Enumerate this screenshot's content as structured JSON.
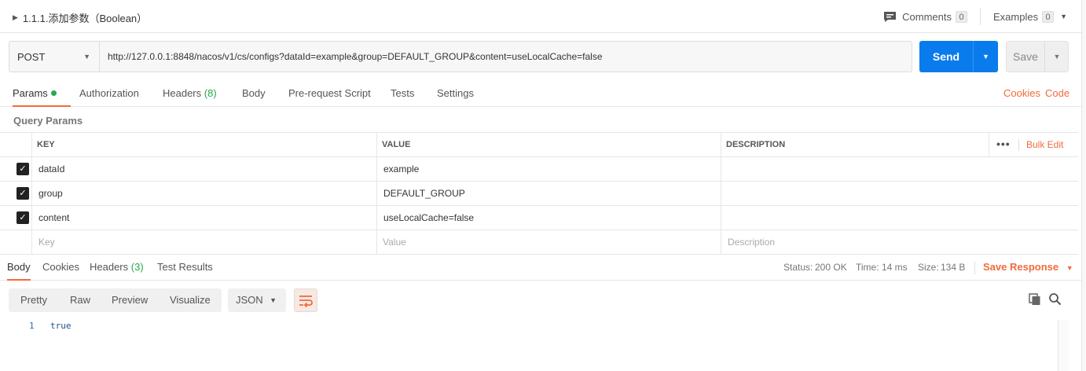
{
  "header": {
    "request_name": "1.1.1.添加参数（Boolean）",
    "comments_label": "Comments",
    "comments_count": "0",
    "examples_label": "Examples",
    "examples_count": "0"
  },
  "request": {
    "method": "POST",
    "url": "http://127.0.0.1:8848/nacos/v1/cs/configs?dataId=example&group=DEFAULT_GROUP&content=useLocalCache=false",
    "send_label": "Send",
    "save_label": "Save"
  },
  "request_tabs": {
    "params": "Params",
    "authorization": "Authorization",
    "headers": "Headers",
    "headers_count": "(8)",
    "body": "Body",
    "prerequest": "Pre-request Script",
    "tests": "Tests",
    "settings": "Settings",
    "cookies": "Cookies",
    "code": "Code"
  },
  "query_params": {
    "title": "Query Params",
    "columns": {
      "key": "KEY",
      "value": "VALUE",
      "description": "DESCRIPTION"
    },
    "bulk_edit": "Bulk Edit",
    "rows": [
      {
        "checked": true,
        "key": "dataId",
        "value": "example",
        "description": ""
      },
      {
        "checked": true,
        "key": "group",
        "value": "DEFAULT_GROUP",
        "description": ""
      },
      {
        "checked": true,
        "key": "content",
        "value": "useLocalCache=false",
        "description": ""
      }
    ],
    "placeholders": {
      "key": "Key",
      "value": "Value",
      "description": "Description"
    }
  },
  "response": {
    "tabs": {
      "body": "Body",
      "cookies": "Cookies",
      "headers": "Headers",
      "headers_count": "(3)",
      "test_results": "Test Results"
    },
    "status_label": "Status:",
    "status_value": "200 OK",
    "time_label": "Time:",
    "time_value": "14 ms",
    "size_label": "Size:",
    "size_value": "134 B",
    "save_response": "Save Response",
    "view_modes": [
      "Pretty",
      "Raw",
      "Preview",
      "Visualize"
    ],
    "format": "JSON",
    "lines": [
      {
        "number": "1",
        "text": "true"
      }
    ]
  },
  "colors": {
    "accent": "#f26b3a",
    "send_button": "#097bed",
    "success": "#26a94c"
  },
  "icons": [
    "caret-right-icon",
    "comment-icon",
    "chevron-down-icon",
    "checkbox-checked-icon",
    "more-dots-icon",
    "wrap-lines-icon",
    "copy-icon",
    "search-icon"
  ]
}
